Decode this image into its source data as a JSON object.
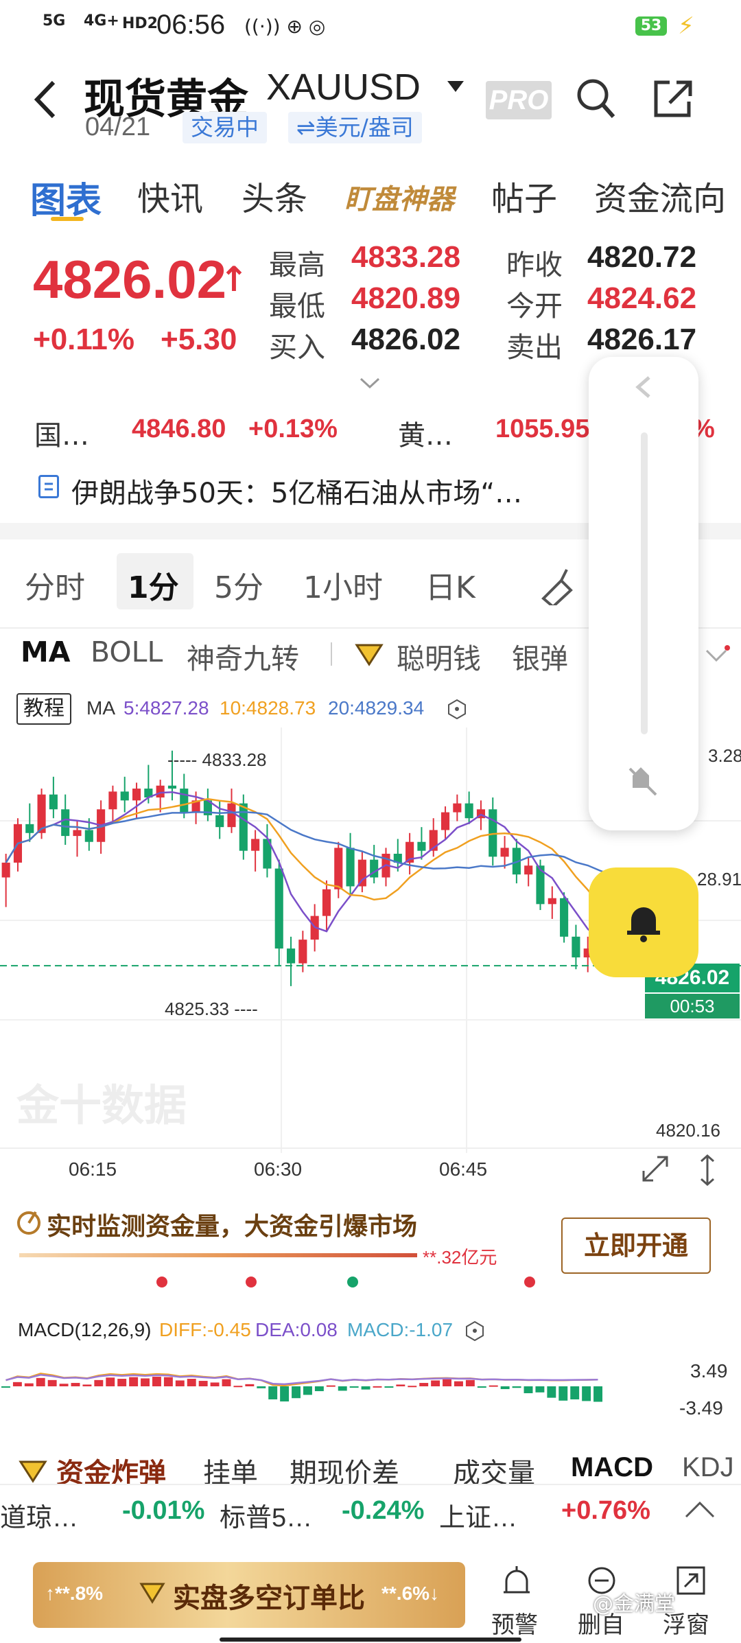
{
  "status": {
    "network1": "5G",
    "network2": "4G+",
    "hd": "HD2",
    "time": "06:56",
    "battery": "53"
  },
  "header": {
    "title": "现货黄金",
    "code": "XAUUSD",
    "date": "04/21",
    "status_pill": "交易中",
    "unit_pill": "⇌美元/盎司",
    "pro": "PRO"
  },
  "tabs": [
    "图表",
    "快讯",
    "头条",
    "盯盘神器",
    "帖子",
    "资金流向"
  ],
  "quote": {
    "price": "4826.02",
    "arrow": "↑",
    "pct": "+0.11%",
    "chg": "+5.30",
    "high_label": "最高",
    "high": "4833.28",
    "low_label": "最低",
    "low": "4820.89",
    "buy_label": "买入",
    "buy": "4826.02",
    "prev_label": "昨收",
    "prev": "4820.72",
    "open_label": "今开",
    "open": "4824.62",
    "sell_label": "卖出",
    "sell": "4826.17"
  },
  "related": [
    {
      "name": "国…",
      "price": "4846.80",
      "pct": "+0.13%"
    },
    {
      "name": "黄…",
      "price": "1055.95",
      "pct": "%"
    }
  ],
  "news": "伊朗战争50天：5亿桶石油从市场“…",
  "periods": [
    "分时",
    "1分",
    "5分",
    "1小时",
    "日K"
  ],
  "indicators": [
    "MA",
    "BOLL",
    "神奇九转",
    "聪明钱",
    "银弹"
  ],
  "ma_legend": {
    "tutorial": "教程",
    "prefix": "MA",
    "ma5": "5:4827.28",
    "ma10": "10:4828.73",
    "ma20": "20:4829.34"
  },
  "chart_axis": {
    "high_mark": "4833.28",
    "low_mark": "4825.33",
    "right_top": "3.28",
    "right_mid": "28.91",
    "last_price": "4826.02",
    "countdown": "00:53",
    "bottom": "4820.16",
    "times": [
      "06:15",
      "06:30",
      "06:45"
    ],
    "watermark": "金十数据"
  },
  "chart_data": {
    "type": "candlestick",
    "x": [
      "06:05",
      "06:06",
      "06:07",
      "06:08",
      "06:09",
      "06:10",
      "06:11",
      "06:12",
      "06:13",
      "06:14",
      "06:15",
      "06:16",
      "06:17",
      "06:18",
      "06:19",
      "06:20",
      "06:21",
      "06:22",
      "06:23",
      "06:24",
      "06:25",
      "06:26",
      "06:27",
      "06:28",
      "06:29",
      "06:30",
      "06:31",
      "06:32",
      "06:33",
      "06:34",
      "06:35",
      "06:36",
      "06:37",
      "06:38",
      "06:39",
      "06:40",
      "06:41",
      "06:42",
      "06:43",
      "06:44",
      "06:45",
      "06:46",
      "06:47",
      "06:48",
      "06:49",
      "06:50",
      "06:51",
      "06:52",
      "06:53",
      "06:54",
      "06:55",
      "06:56"
    ],
    "ohlc": [
      [
        4829.0,
        4829.8,
        4828.0,
        4829.5
      ],
      [
        4829.5,
        4831.0,
        4829.2,
        4830.8
      ],
      [
        4830.8,
        4831.5,
        4830.2,
        4830.5
      ],
      [
        4830.5,
        4832.0,
        4830.3,
        4831.8
      ],
      [
        4831.8,
        4832.4,
        4831.0,
        4831.3
      ],
      [
        4831.3,
        4831.8,
        4830.1,
        4830.4
      ],
      [
        4830.4,
        4830.9,
        4829.7,
        4830.6
      ],
      [
        4830.6,
        4831.0,
        4829.9,
        4830.2
      ],
      [
        4830.2,
        4831.6,
        4829.8,
        4831.3
      ],
      [
        4831.3,
        4832.1,
        4830.9,
        4831.9
      ],
      [
        4831.9,
        4832.4,
        4831.2,
        4831.6
      ],
      [
        4831.6,
        4832.2,
        4831.0,
        4832.0
      ],
      [
        4832.0,
        4832.8,
        4831.5,
        4831.7
      ],
      [
        4831.7,
        4832.3,
        4831.2,
        4832.1
      ],
      [
        4832.1,
        4833.28,
        4831.6,
        4832.0
      ],
      [
        4832.0,
        4832.5,
        4831.0,
        4831.2
      ],
      [
        4831.2,
        4831.9,
        4830.8,
        4831.6
      ],
      [
        4831.6,
        4832.0,
        4830.9,
        4831.1
      ],
      [
        4831.1,
        4831.6,
        4830.3,
        4830.7
      ],
      [
        4830.7,
        4832.0,
        4830.5,
        4831.5
      ],
      [
        4831.5,
        4831.8,
        4829.6,
        4829.9
      ],
      [
        4829.9,
        4830.6,
        4829.2,
        4830.3
      ],
      [
        4830.3,
        4830.8,
        4829.0,
        4829.3
      ],
      [
        4829.3,
        4829.6,
        4826.0,
        4826.6
      ],
      [
        4826.6,
        4827.0,
        4825.33,
        4826.1
      ],
      [
        4826.1,
        4827.2,
        4825.8,
        4826.9
      ],
      [
        4826.9,
        4828.1,
        4826.5,
        4827.7
      ],
      [
        4827.7,
        4828.9,
        4827.2,
        4828.6
      ],
      [
        4828.6,
        4830.2,
        4828.3,
        4830.0
      ],
      [
        4830.0,
        4830.5,
        4828.4,
        4828.7
      ],
      [
        4828.7,
        4829.9,
        4828.5,
        4829.6
      ],
      [
        4829.6,
        4830.1,
        4828.8,
        4829.0
      ],
      [
        4829.0,
        4830.0,
        4828.7,
        4829.8
      ],
      [
        4829.8,
        4830.3,
        4829.2,
        4829.5
      ],
      [
        4829.5,
        4830.5,
        4829.1,
        4830.2
      ],
      [
        4830.2,
        4830.7,
        4829.6,
        4829.9
      ],
      [
        4829.9,
        4831.0,
        4829.7,
        4830.6
      ],
      [
        4830.6,
        4831.4,
        4830.3,
        4831.2
      ],
      [
        4831.2,
        4831.8,
        4830.9,
        4831.5
      ],
      [
        4831.5,
        4831.9,
        4830.8,
        4831.0
      ],
      [
        4831.0,
        4831.6,
        4830.6,
        4831.3
      ],
      [
        4831.3,
        4831.7,
        4829.4,
        4829.7
      ],
      [
        4829.7,
        4830.4,
        4829.3,
        4830.0
      ],
      [
        4830.0,
        4830.3,
        4828.8,
        4829.1
      ],
      [
        4829.1,
        4829.7,
        4828.7,
        4829.4
      ],
      [
        4829.4,
        4829.6,
        4827.9,
        4828.1
      ],
      [
        4828.1,
        4828.7,
        4827.6,
        4828.3
      ],
      [
        4828.3,
        4828.5,
        4826.8,
        4827.0
      ],
      [
        4827.0,
        4827.4,
        4825.9,
        4826.3
      ],
      [
        4826.3,
        4827.0,
        4825.8,
        4826.6
      ],
      [
        4826.6,
        4826.9,
        4825.9,
        4826.2
      ],
      [
        4826.2,
        4826.5,
        4825.8,
        4826.02
      ]
    ],
    "ylim": [
      4820.16,
      4833.6
    ],
    "series": [
      {
        "name": "MA5",
        "color": "#7b4fc9"
      },
      {
        "name": "MA10",
        "color": "#f0a020"
      },
      {
        "name": "MA20",
        "color": "#4a78c8"
      }
    ]
  },
  "fund_monitor": {
    "title": "实时监测资金量，大资金引爆市场",
    "amount": "**.32亿元",
    "button": "立即开通"
  },
  "macd": {
    "label": "MACD(12,26,9)",
    "diff": "DIFF:-0.45",
    "dea": "DEA:0.08",
    "macd": "MACD:-1.07",
    "top": "3.49",
    "bottom": "-3.49"
  },
  "bottom_tabs": [
    "资金炸弹",
    "挂单",
    "期现价差",
    "成交量",
    "MACD",
    "KDJ"
  ],
  "tickers": [
    {
      "name": "道琼…",
      "pct": "-0.01%"
    },
    {
      "name": "标普5…",
      "pct": "-0.24%"
    },
    {
      "name": "上证…",
      "pct": "+0.76%"
    }
  ],
  "footer": {
    "left_pct": "↑**.8%",
    "banner": "实盘多空订单比",
    "right_pct": "**.6%↓",
    "alert": "预警",
    "delete": "删自",
    "float": "浮窗",
    "watermark": "@金满堂"
  },
  "colors": {
    "up": "#e0323e",
    "down": "#16a36a",
    "accent": "#2f6fd0",
    "bell": "#f8dc3a"
  }
}
